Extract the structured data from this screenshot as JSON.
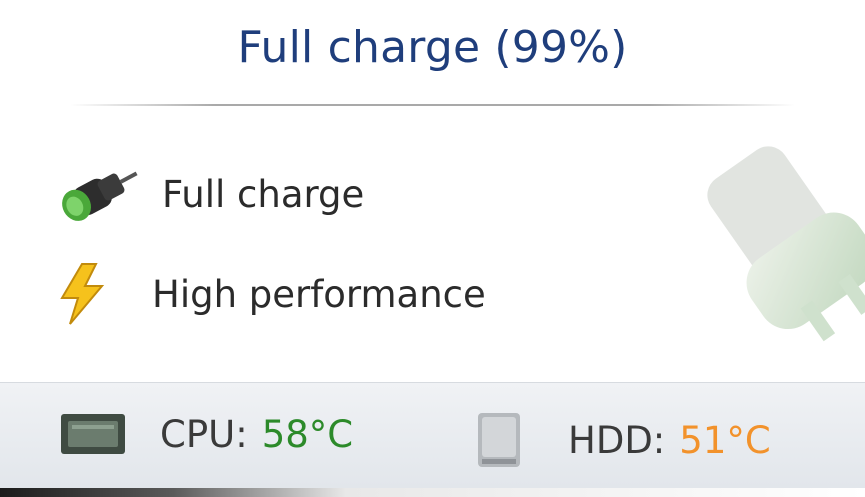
{
  "header": {
    "title": "Full charge (99%)"
  },
  "plans": [
    {
      "label": "Full charge",
      "icon": "battery-plug-icon"
    },
    {
      "label": "High performance",
      "icon": "lightning-icon"
    }
  ],
  "status": {
    "cpu": {
      "label": "CPU:",
      "value": "58°C",
      "icon": "cpu-chip-icon",
      "color": "#2c8a2a"
    },
    "hdd": {
      "label": "HDD:",
      "value": "51°C",
      "icon": "hard-drive-icon",
      "color": "#f2922b"
    }
  }
}
